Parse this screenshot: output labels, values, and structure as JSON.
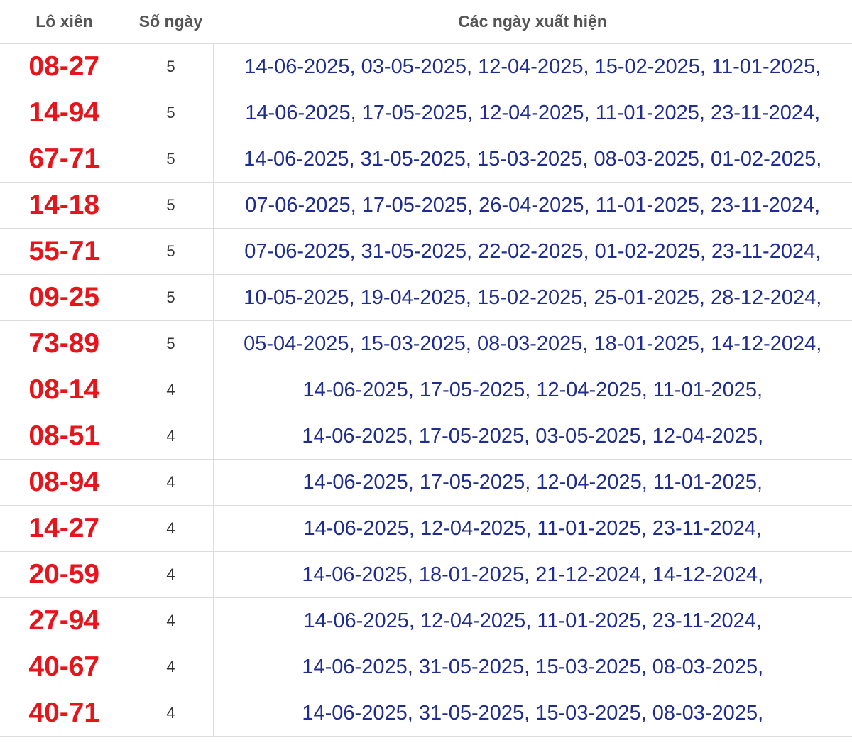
{
  "header": {
    "col_pair": "Lô xiên",
    "col_days": "Số ngày",
    "col_dates": "Các ngày xuất hiện"
  },
  "rows": [
    {
      "pair": "08-27",
      "days": "5",
      "dates": "14-06-2025, 03-05-2025, 12-04-2025, 15-02-2025, 11-01-2025,"
    },
    {
      "pair": "14-94",
      "days": "5",
      "dates": "14-06-2025, 17-05-2025, 12-04-2025, 11-01-2025, 23-11-2024,"
    },
    {
      "pair": "67-71",
      "days": "5",
      "dates": "14-06-2025, 31-05-2025, 15-03-2025, 08-03-2025, 01-02-2025,"
    },
    {
      "pair": "14-18",
      "days": "5",
      "dates": "07-06-2025, 17-05-2025, 26-04-2025, 11-01-2025, 23-11-2024,"
    },
    {
      "pair": "55-71",
      "days": "5",
      "dates": "07-06-2025, 31-05-2025, 22-02-2025, 01-02-2025, 23-11-2024,"
    },
    {
      "pair": "09-25",
      "days": "5",
      "dates": "10-05-2025, 19-04-2025, 15-02-2025, 25-01-2025, 28-12-2024,"
    },
    {
      "pair": "73-89",
      "days": "5",
      "dates": "05-04-2025, 15-03-2025, 08-03-2025, 18-01-2025, 14-12-2024,"
    },
    {
      "pair": "08-14",
      "days": "4",
      "dates": "14-06-2025, 17-05-2025, 12-04-2025, 11-01-2025,"
    },
    {
      "pair": "08-51",
      "days": "4",
      "dates": "14-06-2025, 17-05-2025, 03-05-2025, 12-04-2025,"
    },
    {
      "pair": "08-94",
      "days": "4",
      "dates": "14-06-2025, 17-05-2025, 12-04-2025, 11-01-2025,"
    },
    {
      "pair": "14-27",
      "days": "4",
      "dates": "14-06-2025, 12-04-2025, 11-01-2025, 23-11-2024,"
    },
    {
      "pair": "20-59",
      "days": "4",
      "dates": "14-06-2025, 18-01-2025, 21-12-2024, 14-12-2024,"
    },
    {
      "pair": "27-94",
      "days": "4",
      "dates": "14-06-2025, 12-04-2025, 11-01-2025, 23-11-2024,"
    },
    {
      "pair": "40-67",
      "days": "4",
      "dates": "14-06-2025, 31-05-2025, 15-03-2025, 08-03-2025,"
    },
    {
      "pair": "40-71",
      "days": "4",
      "dates": "14-06-2025, 31-05-2025, 15-03-2025, 08-03-2025,"
    }
  ],
  "colors": {
    "pair_text": "#e8141b",
    "dates_text": "#1f2d8f",
    "accent_bar": "#e0322b"
  }
}
